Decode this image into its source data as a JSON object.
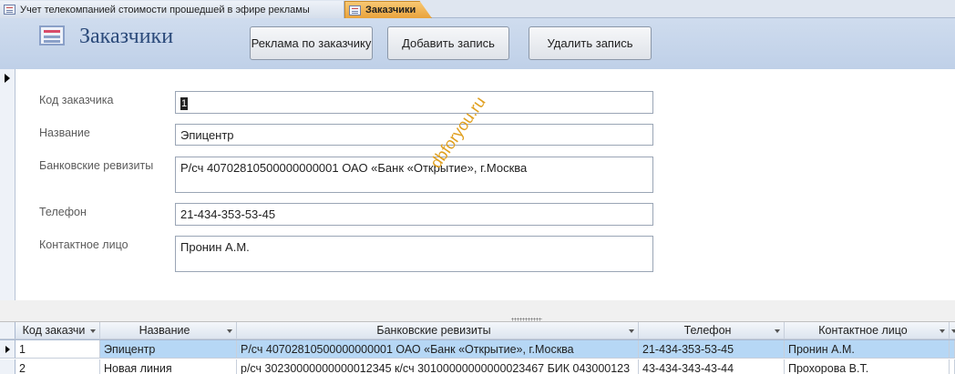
{
  "tabs": [
    {
      "label": "Учет телекомпанией стоимости прошедшей в эфире рекламы",
      "active": false
    },
    {
      "label": "Заказчики",
      "active": true
    }
  ],
  "form": {
    "title": "Заказчики",
    "buttons": {
      "ads_by_customer": "Реклама по заказчику",
      "add_record": "Добавить запись",
      "delete_record": "Удалить запись"
    },
    "fields": {
      "customer_code": {
        "label": "Код заказчика",
        "value": "1"
      },
      "name": {
        "label": "Название",
        "value": "Эпицентр"
      },
      "bank_details": {
        "label": "Банковские ревизиты",
        "value": "Р/сч 40702810500000000001 ОАО «Банк «Открытие», г.Москва"
      },
      "phone": {
        "label": "Телефон",
        "value": "21-434-353-53-45"
      },
      "contact": {
        "label": "Контактное лицо",
        "value": "Пронин А.М."
      }
    }
  },
  "watermark": "dbforyou.ru",
  "datasheet": {
    "columns": [
      "Код заказчи",
      "Название",
      "Банковские ревизиты",
      "Телефон",
      "Контактное лицо"
    ],
    "rows": [
      [
        "1",
        "Эпицентр",
        "Р/сч 40702810500000000001 ОАО «Банк «Открытие», г.Москва",
        "21-434-353-53-45",
        "Пронин А.М."
      ],
      [
        "2",
        "Новая линия",
        "р/сч 30230000000000012345 к/сч 30100000000000023467 БИК 043000123",
        "43-434-343-43-44",
        "Прохорова В.Т."
      ]
    ]
  },
  "colors": {
    "header_band": "#c6d6ec",
    "active_tab": "#f2b85a",
    "selected_row": "#b6d7f5",
    "title_text": "#2b4a7a"
  }
}
